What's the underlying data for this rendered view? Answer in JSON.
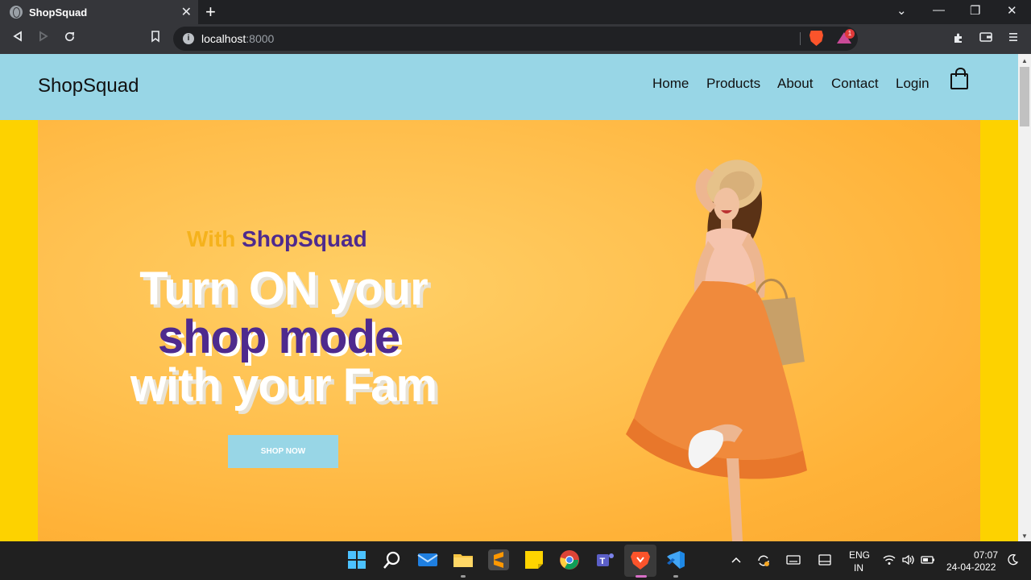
{
  "browser": {
    "tab_title": "ShopSquad",
    "tab_close": "✕",
    "new_tab": "+",
    "window_controls": [
      "⌄",
      "—",
      "❐",
      "✕"
    ],
    "url_host": "localhost",
    "url_port": ":8000",
    "rewards_count": "1",
    "colors": {
      "brave_orange": "#fb542b"
    }
  },
  "site": {
    "logo": "ShopSquad",
    "nav": [
      "Home",
      "Products",
      "About",
      "Contact",
      "Login"
    ],
    "cart_icon": "shopping-bag-icon",
    "hero": {
      "tagline_with": "With",
      "tagline_brand": "ShopSquad",
      "line1": "Turn ON your",
      "line2": "shop mode",
      "line3": "with your Fam",
      "button": "SHOP NOW"
    },
    "colors": {
      "header_bg": "#98d6e6",
      "page_bg": "#fdd200",
      "hero_bg": "#ffc04f",
      "brand_purple": "#4e2a8e",
      "accent_yellow": "#f5b21c"
    }
  },
  "taskbar": {
    "apps": [
      "start-icon",
      "search-icon",
      "mail-icon",
      "file-explorer-icon",
      "sublime-text-icon",
      "sticky-notes-icon",
      "chrome-icon",
      "teams-icon",
      "brave-icon",
      "vscode-icon"
    ],
    "lang_top": "ENG",
    "lang_bottom": "IN",
    "time": "07:07",
    "date": "24-04-2022"
  }
}
